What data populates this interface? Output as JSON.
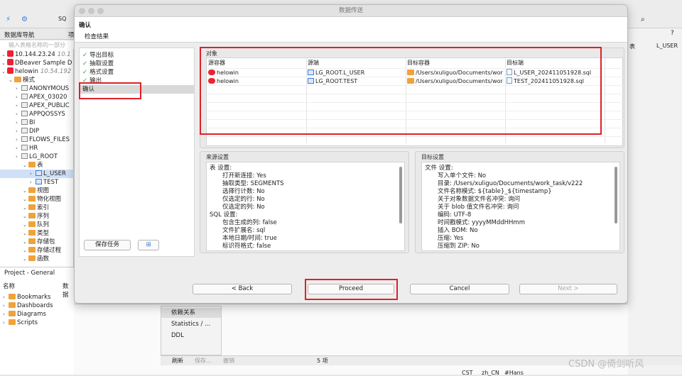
{
  "toolbar": {
    "sql_label": "SQ"
  },
  "left": {
    "nav_tab": "数据库导航",
    "nav_tab2": "项",
    "filter_placeholder": "输入表格名称的一部分",
    "tree": [
      {
        "indent": 0,
        "type": "db",
        "label": "10.144.23.24",
        "extra": "10.1"
      },
      {
        "indent": 0,
        "type": "db",
        "label": "DBeaver Sample D"
      },
      {
        "indent": 0,
        "type": "db",
        "label": "helowin",
        "extra": "10.54.192"
      },
      {
        "indent": 1,
        "type": "folder",
        "label": "模式"
      },
      {
        "indent": 2,
        "type": "schema",
        "label": "ANONYMOUS"
      },
      {
        "indent": 2,
        "type": "schema",
        "label": "APEX_03020"
      },
      {
        "indent": 2,
        "type": "schema",
        "label": "APEX_PUBLIC"
      },
      {
        "indent": 2,
        "type": "schema",
        "label": "APPQOSSYS"
      },
      {
        "indent": 2,
        "type": "schema",
        "label": "BI"
      },
      {
        "indent": 2,
        "type": "schema",
        "label": "DIP"
      },
      {
        "indent": 2,
        "type": "schema",
        "label": "FLOWS_FILES"
      },
      {
        "indent": 2,
        "type": "schema",
        "label": "HR"
      },
      {
        "indent": 2,
        "type": "schema",
        "label": "LG_ROOT"
      },
      {
        "indent": 3,
        "type": "folder",
        "label": "表"
      },
      {
        "indent": 4,
        "type": "table",
        "label": "L_USER"
      },
      {
        "indent": 4,
        "type": "table",
        "label": "TEST"
      },
      {
        "indent": 3,
        "type": "folder",
        "label": "视图"
      },
      {
        "indent": 3,
        "type": "folder",
        "label": "物化视图"
      },
      {
        "indent": 3,
        "type": "folder",
        "label": "索引"
      },
      {
        "indent": 3,
        "type": "folder",
        "label": "序列"
      },
      {
        "indent": 3,
        "type": "folder",
        "label": "队列"
      },
      {
        "indent": 3,
        "type": "folder",
        "label": "类型"
      },
      {
        "indent": 3,
        "type": "folder",
        "label": "存储包"
      },
      {
        "indent": 3,
        "type": "folder",
        "label": "存储过程"
      },
      {
        "indent": 3,
        "type": "folder",
        "label": "函数"
      }
    ],
    "project_title": "Project - General",
    "project_cols": [
      "名称",
      "数据"
    ],
    "project_items": [
      "Bookmarks",
      "Dashboards",
      "Diagrams",
      "Scripts"
    ]
  },
  "right": {
    "crumb_table": "表",
    "crumb_item": "L_USER"
  },
  "bottom": {
    "side_items": [
      "依赖关系",
      "Statistics / ...",
      "DDL"
    ],
    "bar": {
      "refresh": "刷新",
      "save": "保存...",
      "cancel": "撤销",
      "count": "5 项"
    },
    "status": [
      "CST",
      "zh_CN",
      "#Hans"
    ],
    "watermark": "CSDN @倚剑听风"
  },
  "dialog": {
    "title": "数据传送",
    "header_title": "确认",
    "header_sub": "检查结果",
    "steps": [
      {
        "label": "导出目标",
        "done": true
      },
      {
        "label": "抽取设置",
        "done": true
      },
      {
        "label": "格式设置",
        "done": true
      },
      {
        "label": "输出",
        "done": true
      },
      {
        "label": "确认",
        "done": false,
        "active": true
      }
    ],
    "save_task": "保存任务",
    "objects_title": "对象",
    "columns": [
      "源容器",
      "源端",
      "目标容器",
      "目标端"
    ],
    "rows": [
      {
        "src_container": "helowin",
        "src": "LG_ROOT.L_USER",
        "dst_container": "/Users/xuliguo/Documents/wor",
        "dst": "L_USER_202411051928.sql"
      },
      {
        "src_container": "helowin",
        "src": "LG_ROOT.TEST",
        "dst_container": "/Users/xuliguo/Documents/wor",
        "dst": "TEST_202411051928.sql"
      }
    ],
    "source_title": "来源设置",
    "source_lines": [
      {
        "t": "表 设置:",
        "i": 0
      },
      {
        "t": "打开新连接: Yes",
        "i": 1
      },
      {
        "t": "抽取类型: SEGMENTS",
        "i": 1
      },
      {
        "t": "选择行计数: No",
        "i": 1
      },
      {
        "t": "仅选定的行: No",
        "i": 1
      },
      {
        "t": "仅选定的列: No",
        "i": 1
      },
      {
        "t": "SQL 设置:",
        "i": 0
      },
      {
        "t": "包含生成的列: false",
        "i": 1
      },
      {
        "t": "文件扩展名: sql",
        "i": 1
      },
      {
        "t": "本地日期/时间: true",
        "i": 1
      },
      {
        "t": "标识符格式: false",
        "i": 1
      }
    ],
    "target_title": "目标设置",
    "target_lines": [
      {
        "t": "文件 设置:",
        "i": 0
      },
      {
        "t": "写入单个文件: No",
        "i": 1
      },
      {
        "t": "目录: /Users/xuliguo/Documents/work_task/v222",
        "i": 1
      },
      {
        "t": "文件名称模式: ${table}_${timestamp}",
        "i": 1
      },
      {
        "t": "关于对象数据文件名冲突: 询问",
        "i": 1
      },
      {
        "t": "关于 blob 值文件名冲突: 询问",
        "i": 1
      },
      {
        "t": "编码: UTF-8",
        "i": 1
      },
      {
        "t": "时间戳模式: yyyyMMddHHmm",
        "i": 1
      },
      {
        "t": "插入 BOM: No",
        "i": 1
      },
      {
        "t": "压缩: Yes",
        "i": 1
      },
      {
        "t": "压缩到 ZIP: No",
        "i": 1
      }
    ],
    "buttons": {
      "back": "< Back",
      "proceed": "Proceed",
      "cancel": "Cancel",
      "next": "Next >"
    }
  }
}
